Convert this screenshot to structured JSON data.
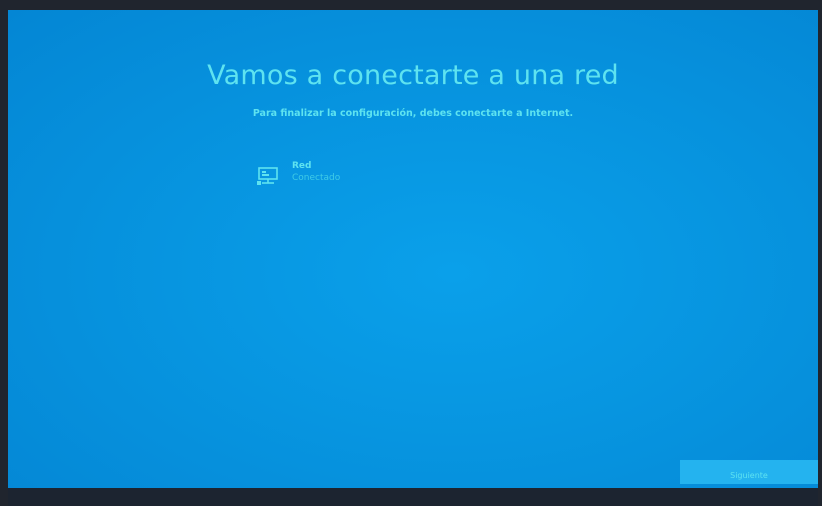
{
  "setup": {
    "title": "Vamos a conectarte a una red",
    "subtitle": "Para finalizar la configuración, debes conectarte a Internet.",
    "network": {
      "icon": "wired-network-icon",
      "name": "Red",
      "status": "Conectado"
    },
    "next_label": "Siguiente"
  },
  "colors": {
    "background": "#0795e0",
    "text_accent": "#5ee3f0",
    "button": "#24b3ef"
  }
}
